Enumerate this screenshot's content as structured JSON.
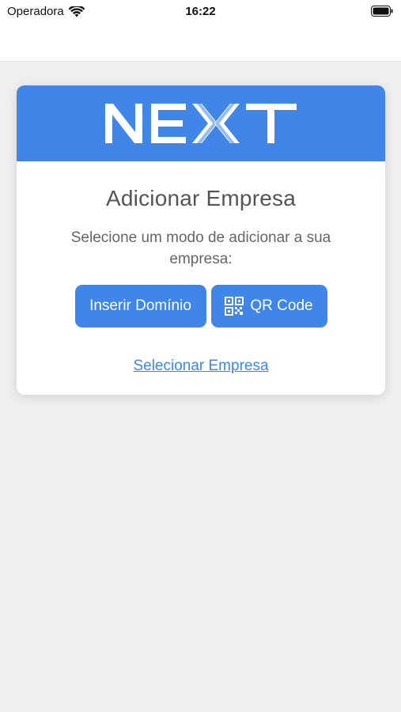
{
  "status_bar": {
    "carrier": "Operadora",
    "time": "16:22"
  },
  "card": {
    "logo_text": "NEXT",
    "title": "Adicionar Empresa",
    "description": "Selecione um modo de adicionar a sua empresa:",
    "buttons": {
      "insert_domain": "Inserir Domínio",
      "qr_code": "QR Code"
    },
    "select_company_link": "Selecionar Empresa"
  },
  "colors": {
    "accent": "#3f86e8",
    "background": "#efefef"
  },
  "icons": [
    "wifi-icon",
    "battery-icon",
    "qr-code-icon"
  ]
}
